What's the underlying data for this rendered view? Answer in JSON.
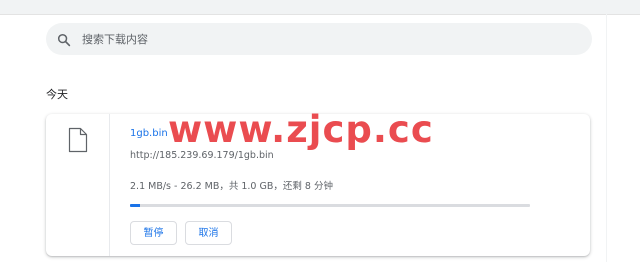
{
  "search": {
    "placeholder": "搜索下载内容",
    "icon": "search-icon"
  },
  "section": {
    "date_label": "今天"
  },
  "download": {
    "file_name": "1gb.bin",
    "url": "http://185.239.69.179/1gb.bin",
    "status": "2.1 MB/s - 26.2 MB，共 1.0 GB，还剩 8 分钟",
    "progress_fraction": 0.026,
    "file_icon": "file-icon",
    "pause_label": "暂停",
    "cancel_label": "取消"
  },
  "watermark": {
    "text": "www.zjcp.cc"
  },
  "colors": {
    "accent": "#1a73e8",
    "watermark": "#ea4c50",
    "progress_track": "#dadce0",
    "search_bg": "#f1f3f4"
  }
}
